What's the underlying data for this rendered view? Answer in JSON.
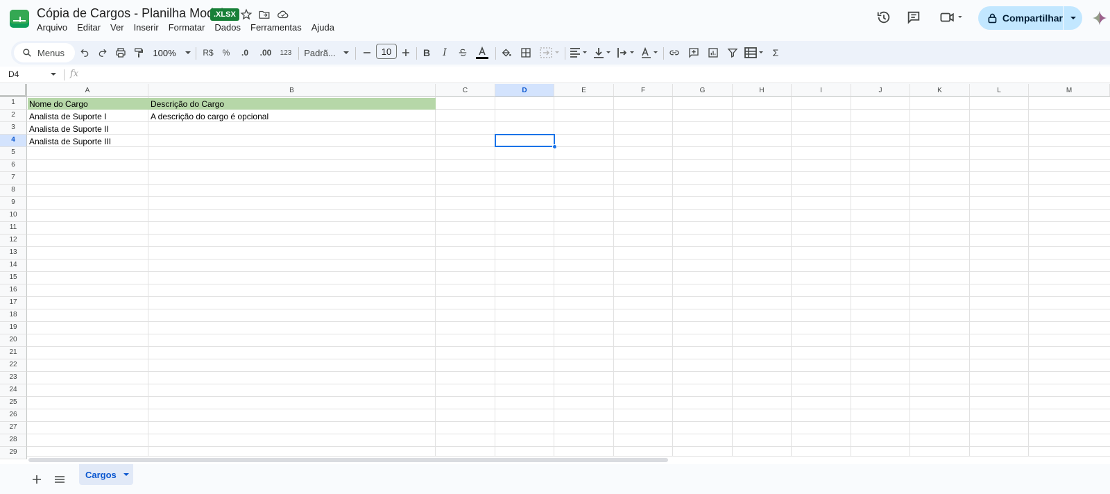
{
  "app": {
    "doc_title": "Cópia de Cargos - Planilha Modelo",
    "file_badge": ".XLSX",
    "menu": [
      "Arquivo",
      "Editar",
      "Ver",
      "Inserir",
      "Formatar",
      "Dados",
      "Ferramentas",
      "Ajuda"
    ],
    "share_label": "Compartilhar"
  },
  "toolbar": {
    "search_label": "Menus",
    "zoom": "100%",
    "currency": "R$",
    "percent": "%",
    "decrease_decimal": ".0",
    "increase_decimal": ".00",
    "number_format": "123",
    "font_family": "Padrã...",
    "font_size": "10",
    "sigma": "Σ"
  },
  "formula_bar": {
    "name_box": "D4",
    "fx": "fx",
    "formula": ""
  },
  "sheet": {
    "columns": [
      "A",
      "B",
      "C",
      "D",
      "E",
      "F",
      "G",
      "H",
      "I",
      "J",
      "K",
      "L",
      "M"
    ],
    "selected_column": "D",
    "selected_row": "4",
    "rows": [
      "1",
      "2",
      "3",
      "4",
      "5",
      "6",
      "7",
      "8",
      "9",
      "10",
      "11",
      "12",
      "13",
      "14",
      "15",
      "16",
      "17",
      "18",
      "19",
      "20",
      "21",
      "22",
      "23",
      "24",
      "25",
      "26",
      "27",
      "28",
      "29"
    ],
    "cells": {
      "A1": "Nome do Cargo",
      "B1": "Descrição do Cargo",
      "A2": "Analista de Suporte I",
      "B2": "A descrição do cargo é opcional",
      "A3": "Analista de Suporte II",
      "A4": "Analista de Suporte III"
    },
    "header_fill": "#b6d7a8",
    "selection_color": "#1a73e8"
  },
  "tabs": {
    "active_sheet": "Cargos"
  }
}
